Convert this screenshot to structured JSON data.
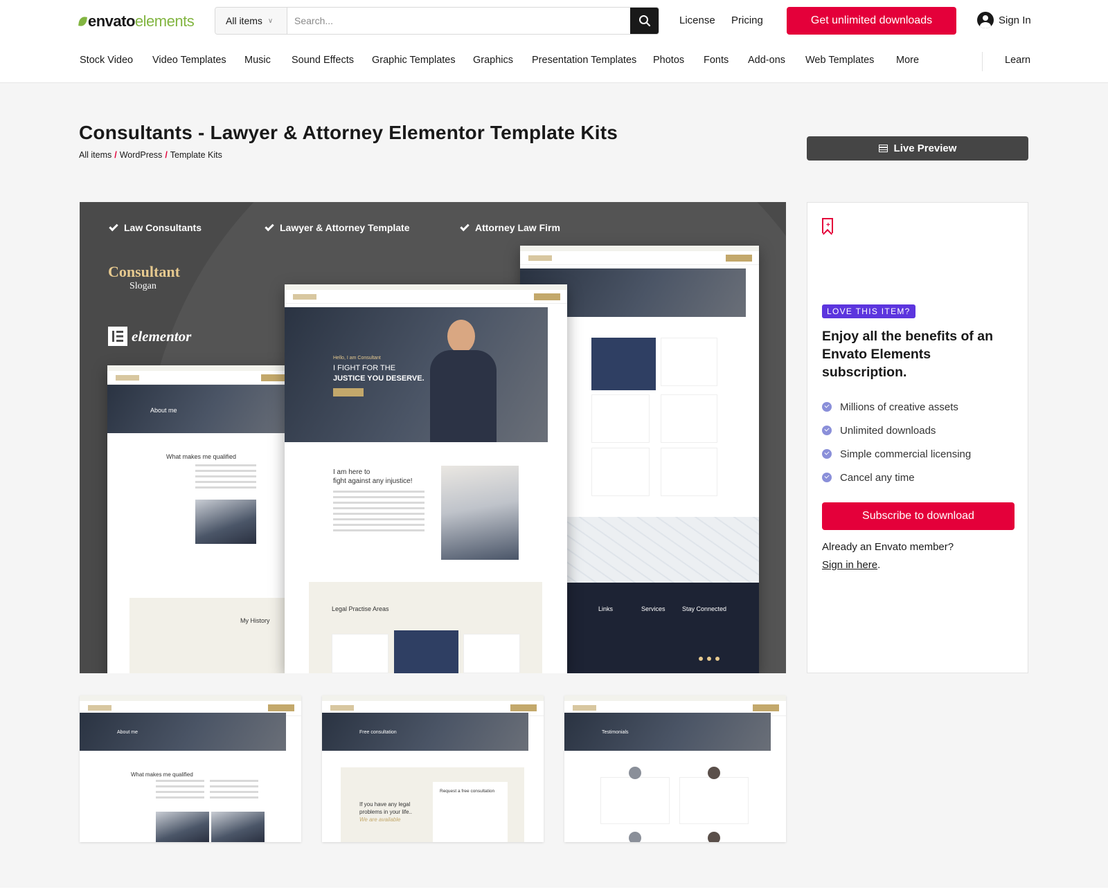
{
  "header": {
    "logo_word1": "envato",
    "logo_word2": "elements",
    "search_category": "All items",
    "search_placeholder": "Search...",
    "links": [
      "License",
      "Pricing"
    ],
    "cta": "Get unlimited downloads",
    "signin": "Sign In"
  },
  "nav": {
    "items": [
      "Stock Video",
      "Video Templates",
      "Music",
      "Sound Effects",
      "Graphic Templates",
      "Graphics",
      "Presentation Templates",
      "Photos",
      "Fonts",
      "Add-ons",
      "Web Templates",
      "More"
    ],
    "learn": "Learn"
  },
  "page": {
    "title": "Consultants - Lawyer & Attorney Elementor Template Kits",
    "breadcrumbs": [
      "All items",
      "WordPress",
      "Template Kits"
    ],
    "live_preview": "Live Preview"
  },
  "preview": {
    "checks": [
      "Law Consultants",
      "Lawyer & Attorney Template",
      "Attorney Law Firm"
    ],
    "brand_name": "Consultant",
    "brand_slogan": "Slogan",
    "elementor": "elementor",
    "hero_small": "Hello, I am Consultant",
    "hero_line1": "I FIGHT FOR THE",
    "hero_line2": "JUSTICE YOU DESERVE.",
    "about_title": "About me",
    "qualified": "What makes me qualified",
    "injustice1": "I am here to",
    "injustice2": "fight against any injustice!",
    "history": "My History",
    "practise": "Legal Practise Areas",
    "footer_cols": [
      "Links",
      "Services",
      "Stay Connected"
    ]
  },
  "thumbnails": [
    {
      "banner": "About me",
      "heading": "What makes me qualified"
    },
    {
      "banner": "Free consultation",
      "heading": "If you have any legal problems in your life..",
      "sub": "We are available",
      "form": "Request a free consultation"
    },
    {
      "banner": "Testimonials",
      "heading": ""
    }
  ],
  "sidebar": {
    "badge": "LOVE THIS ITEM?",
    "heading": "Enjoy all the benefits of an Envato Elements subscription.",
    "features": [
      "Millions of creative assets",
      "Unlimited downloads",
      "Simple commercial licensing",
      "Cancel any time"
    ],
    "subscribe": "Subscribe to download",
    "already": "Already an Envato member?",
    "signin_link": "Sign in here",
    "signin_suffix": "."
  },
  "colors": {
    "accent": "#e4003a",
    "brand_green": "#82b541",
    "badge": "#5c35de",
    "dark": "#454545"
  }
}
